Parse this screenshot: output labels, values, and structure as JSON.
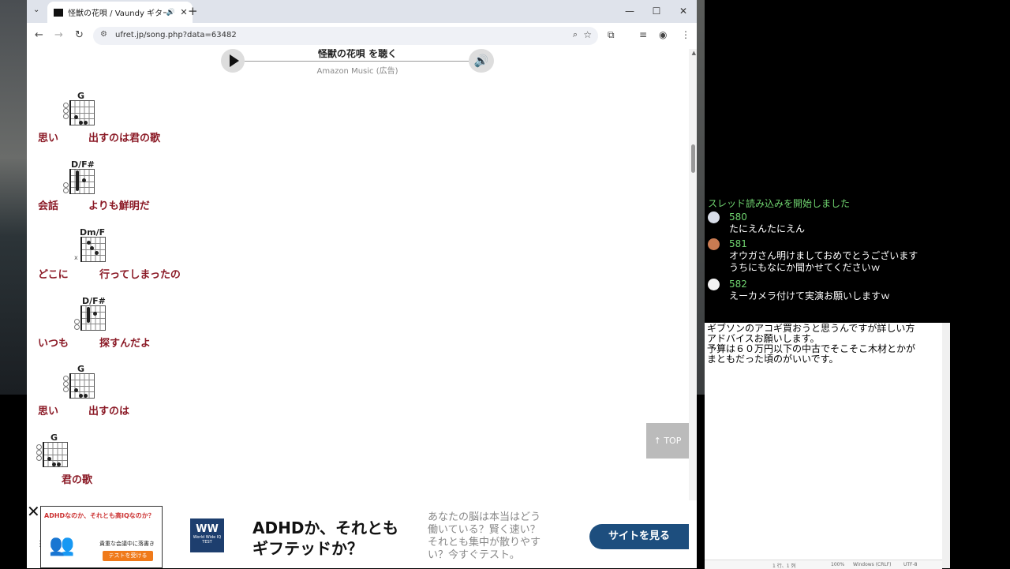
{
  "browser": {
    "tab_title": "怪獣の花唄 / Vaundy ギターコ",
    "tab_audio": "🔊",
    "tab_close": "✕",
    "new_tab": "+",
    "url": "ufret.jp/song.php?data=63482",
    "minimize": "—",
    "maximize": "☐",
    "close": "✕"
  },
  "player": {
    "title": "怪獣の花唄 を聴く",
    "subtitle": "Amazon Music (広告)"
  },
  "chords": [
    {
      "name": "G",
      "lyric_a": "思い",
      "lyric_b": "出すのは君の歌"
    },
    {
      "name": "D/F#",
      "lyric_a": "会話",
      "lyric_b": "よりも鮮明だ"
    },
    {
      "name": "Dm/F",
      "lyric_a": "どこに",
      "lyric_b": "行ってしまったの"
    },
    {
      "name": "D/F#",
      "lyric_a": "いつも",
      "lyric_b": "探すんだよ"
    },
    {
      "name": "G",
      "lyric_a": "思い",
      "lyric_b": "出すのは"
    },
    {
      "name": "G",
      "lyric_a": "",
      "lyric_b": "君の歌"
    }
  ],
  "top_button": "↑ TOP",
  "ad": {
    "close": "✕",
    "image_question": "ADHDなのか、それとも高IQなのか？",
    "image_small": "貴重な会議中に落書き",
    "image_cta": "テストを受ける",
    "logo_main": "WW",
    "logo_sub": "World Wide IQ TEST",
    "headline_1": "ADHDか、それとも",
    "headline_2": "ギフテッドか？",
    "body": "あなたの脳は本当はどう働いている？賢く速い？それとも集中が散りやすい？今すぐテスト。",
    "button": "サイトを見る"
  },
  "chat": {
    "system": "スレッド読み込みを開始しました",
    "messages": [
      {
        "num": "580",
        "lines": [
          "たにえんたにえん"
        ]
      },
      {
        "num": "581",
        "lines": [
          "オウガさん明けましておめでとうございます",
          "うちにもなにか聞かせてくださいｗ"
        ]
      },
      {
        "num": "582",
        "lines": [
          "えーカメラ付けて実演お願いしますｗ"
        ]
      }
    ]
  },
  "notepad": {
    "text": "ギブソンのアコギ買おうと思うんですが詳しい方\nアドバイスお願いします。\n予算は６０万円以下の中古でそこそこ木材とかが\nまともだった頃のがいいです。",
    "status_pos": "1 行、1 列",
    "status_zoom": "100%",
    "status_eol": "Windows (CRLF)",
    "status_enc": "UTF-8"
  }
}
